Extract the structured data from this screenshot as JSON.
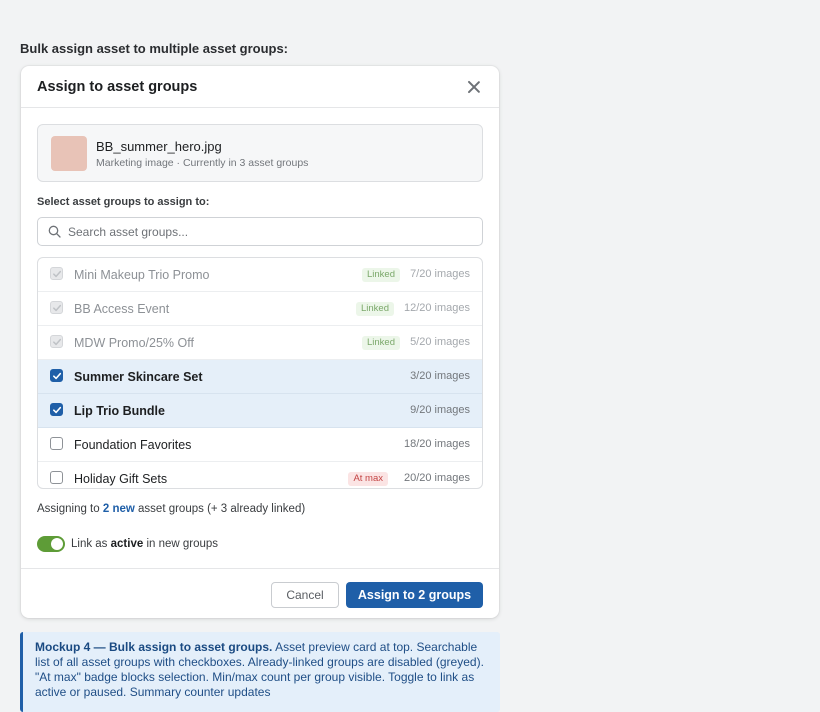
{
  "page": {
    "heading": "Bulk assign asset to multiple asset groups:"
  },
  "modal": {
    "title": "Assign to asset groups",
    "asset": {
      "name": "BB_summer_hero.jpg",
      "meta": "Marketing image · Currently in 3 asset groups",
      "thumb_color": "#e8c3b7"
    },
    "select_label": "Select asset groups to assign to:",
    "search_placeholder": "Search asset groups...",
    "groups": [
      {
        "name": "Mini Makeup Trio Promo",
        "badge": "Linked",
        "count": "7/20 images",
        "state": "disabled"
      },
      {
        "name": "BB Access Event",
        "badge": "Linked",
        "count": "12/20 images",
        "state": "disabled"
      },
      {
        "name": "MDW Promo/25% Off",
        "badge": "Linked",
        "count": "5/20 images",
        "state": "disabled"
      },
      {
        "name": "Summer Skincare Set",
        "badge": "",
        "count": "3/20 images",
        "state": "selected"
      },
      {
        "name": "Lip Trio Bundle",
        "badge": "",
        "count": "9/20 images",
        "state": "selected"
      },
      {
        "name": "Foundation Favorites",
        "badge": "",
        "count": "18/20 images",
        "state": "unchecked"
      },
      {
        "name": "Holiday Gift Sets",
        "badge": "At max",
        "count": "20/20 images",
        "state": "unchecked"
      }
    ],
    "summary": {
      "prefix": "Assigning to ",
      "count": "2 new",
      "suffix": " asset groups (+ 3 already linked)"
    },
    "toggle": {
      "prefix": "Link as ",
      "bold": "active",
      "suffix": " in new groups",
      "on": true
    },
    "cancel_label": "Cancel",
    "assign_label": "Assign to 2 groups"
  },
  "note": {
    "title": "Mockup 4 — Bulk assign to asset groups.",
    "body": " Asset preview card at top. Searchable list of all asset groups with checkboxes. Already-linked groups are disabled (greyed). \"At max\" badge blocks selection. Min/max count per group visible. Toggle to link as active or paused. Summary counter updates"
  },
  "colors": {
    "primary": "#1f5fa8",
    "toggle_on": "#5e9c37",
    "selected_row": "#e5eff9",
    "linked_badge_text": "#7ba86a",
    "max_badge_text": "#c34444"
  }
}
